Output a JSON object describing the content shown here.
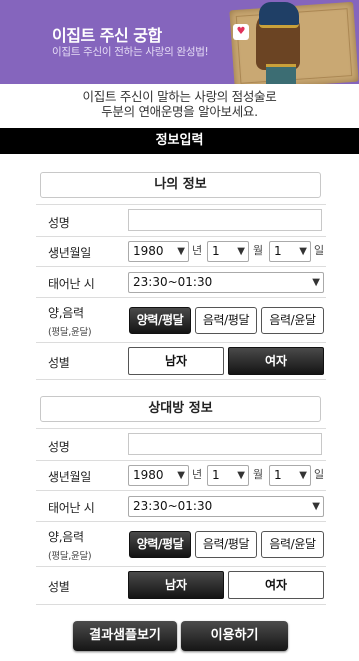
{
  "banner": {
    "title": "이집트 주신 궁합",
    "subtitle": "이집트 주신이 전하는 사랑의 완성법!"
  },
  "intro": {
    "line1": "이집트 주신이 말하는 사랑의 점성술로",
    "line2": "두분의 연애운명을 알아보세요."
  },
  "section_title": "정보입력",
  "labels": {
    "name": "성명",
    "birth": "생년월일",
    "birth_time": "태어난 시",
    "calendar": "양,음력",
    "calendar_sub": "(평달,윤달)",
    "gender": "성별",
    "year_unit": "년",
    "month_unit": "월",
    "day_unit": "일"
  },
  "calendar_options": [
    "양력/평달",
    "음력/평달",
    "음력/윤달"
  ],
  "gender_options": [
    "남자",
    "여자"
  ],
  "my_info": {
    "title": "나의 정보",
    "name_value": "",
    "year": "1980",
    "month": "1",
    "day": "1",
    "time": "23:30~01:30",
    "calendar_selected": "양력/평달",
    "gender_selected": "여자"
  },
  "partner_info": {
    "title": "상대방 정보",
    "name_value": "",
    "year": "1980",
    "month": "1",
    "day": "1",
    "time": "23:30~01:30",
    "calendar_selected": "양력/평달",
    "gender_selected": "남자"
  },
  "actions": {
    "sample": "결과샘플보기",
    "use": "이용하기"
  },
  "icons": {
    "dropdown": "chevron-down-icon",
    "chat": "heart-chat-icon"
  }
}
